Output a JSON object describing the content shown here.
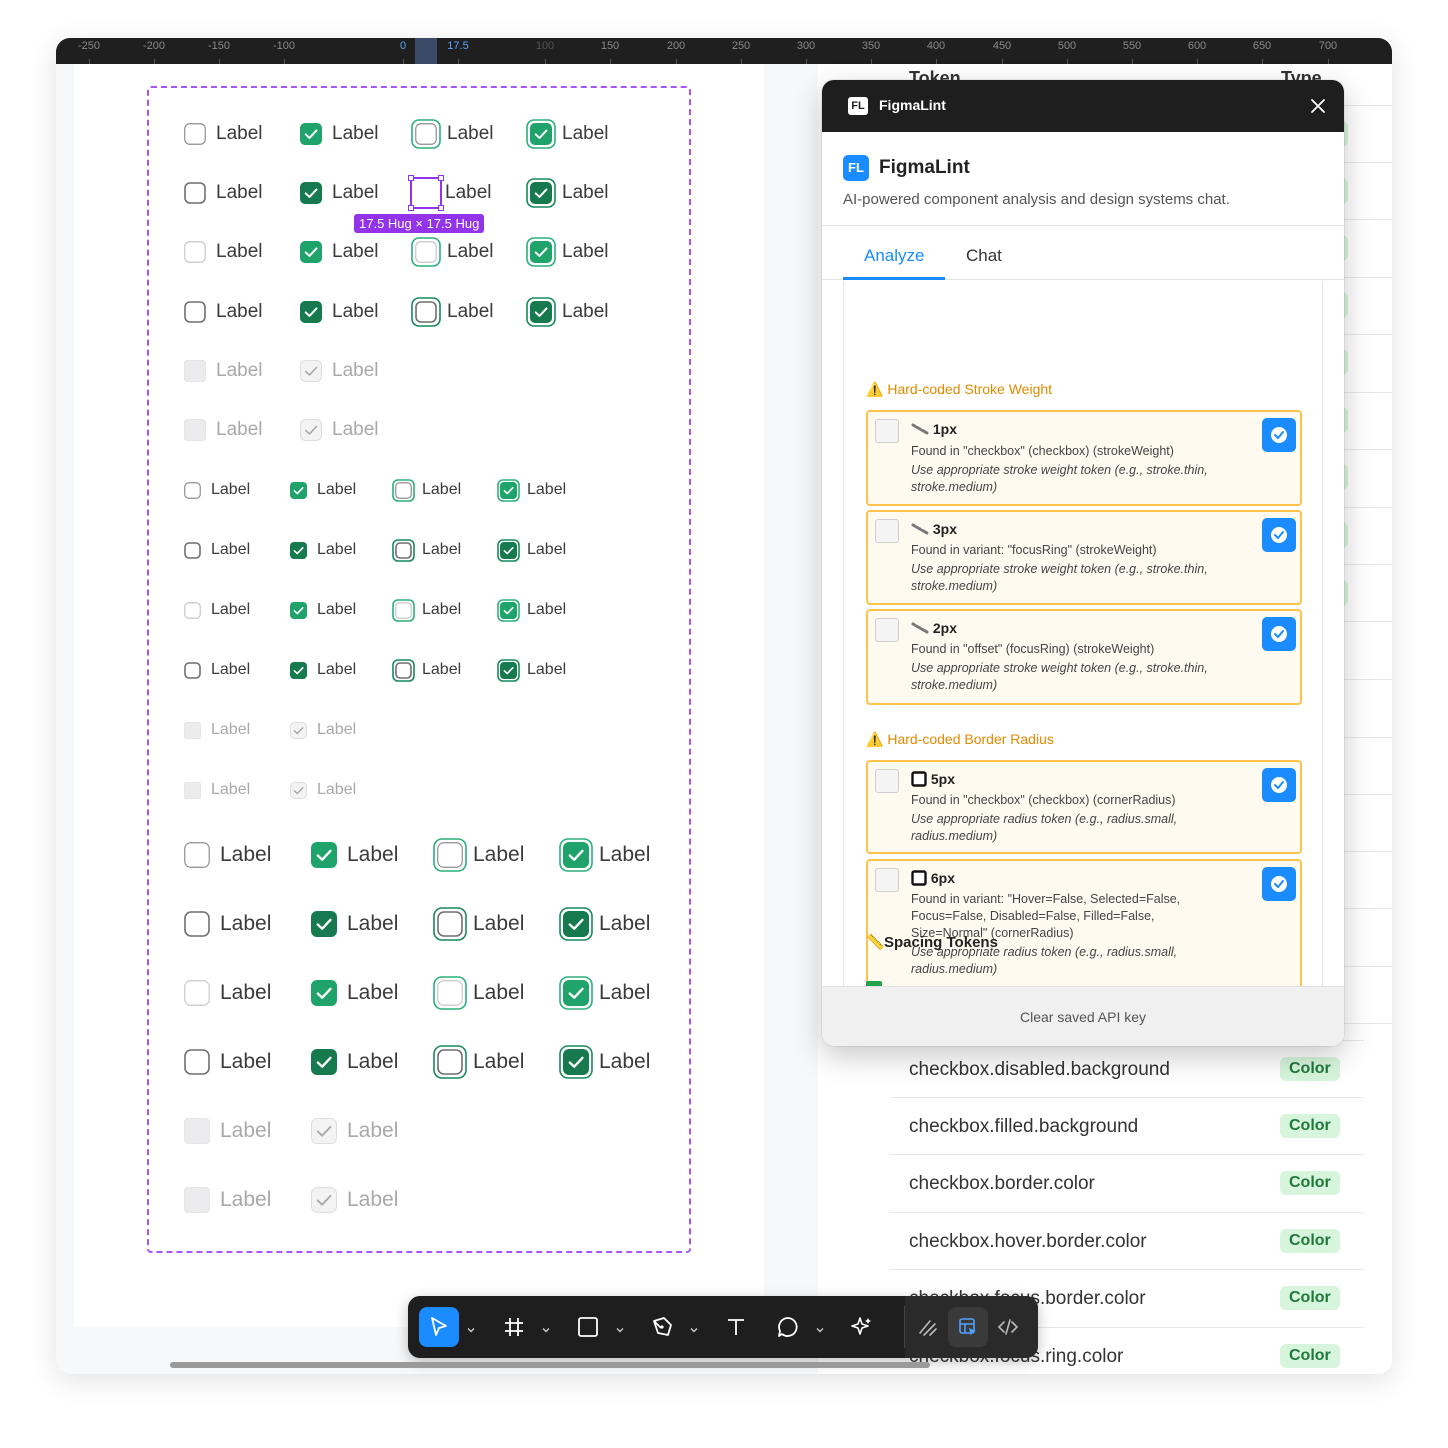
{
  "ruler": {
    "ticks": [
      "-250",
      "-200",
      "-150",
      "-100",
      "0",
      "17.5",
      "100",
      "150",
      "200",
      "250",
      "300",
      "350",
      "400",
      "450",
      "500",
      "550",
      "600",
      "650",
      "700"
    ]
  },
  "canvas": {
    "checkbox_label": "Label",
    "size_tag": "17.5 Hug × 17.5 Hug"
  },
  "tokens": {
    "header_token": "Token",
    "header_type": "Type",
    "rows": [
      {
        "name": "checkbox.disabled.background",
        "type": "Color"
      },
      {
        "name": "checkbox.filled.background",
        "type": "Color"
      },
      {
        "name": "checkbox.border.color",
        "type": "Color"
      },
      {
        "name": "checkbox.hover.border.color",
        "type": "Color"
      },
      {
        "name": "checkbox.focus.border.color",
        "type": "Color"
      },
      {
        "name": "checkbox.focus.ring.color",
        "type": "Color"
      }
    ]
  },
  "plugin": {
    "window_title": "FigmaLint",
    "logo_text": "FL",
    "name": "FigmaLint",
    "description": "AI-powered component analysis and design systems chat.",
    "tabs": [
      {
        "label": "Analyze",
        "active": true
      },
      {
        "label": "Chat",
        "active": false
      }
    ],
    "sections": [
      {
        "title": "Hard-coded Stroke Weight",
        "icon": "warning-icon",
        "issues": [
          {
            "value": "1px",
            "icon": "ruler-icon",
            "found": "Found in \"checkbox\" (checkbox) (strokeWeight)",
            "suggestion": "Use appropriate stroke weight token (e.g., stroke.thin, stroke.medium)"
          },
          {
            "value": "3px",
            "icon": "ruler-icon",
            "found": "Found in variant: \"focusRing\" (strokeWeight)",
            "suggestion": "Use appropriate stroke weight token (e.g., stroke.thin, stroke.medium)"
          },
          {
            "value": "2px",
            "icon": "ruler-icon",
            "found": "Found in \"offset\" (focusRing) (strokeWeight)",
            "suggestion": "Use appropriate stroke weight token (e.g., stroke.thin, stroke.medium)"
          }
        ]
      },
      {
        "title": "Hard-coded Border Radius",
        "icon": "warning-icon",
        "issues": [
          {
            "value": "5px",
            "icon": "square-icon",
            "found": "Found in \"checkbox\" (checkbox) (cornerRadius)",
            "suggestion": "Use appropriate radius token (e.g., radius.small, radius.medium)"
          },
          {
            "value": "6px",
            "icon": "square-icon",
            "found": "Found in variant: \"Hover=False, Selected=False, Focus=False, Disabled=False, Filled=False, Size=Normal\" (cornerRadius)",
            "suggestion": "Use appropriate radius token (e.g., radius.small, radius.medium)"
          }
        ]
      }
    ],
    "spacing_title": "Spacing Tokens",
    "footer_link": "Clear saved API key"
  },
  "colors": {
    "accent": "#1a8cff",
    "checkbox_green": "#1fa36a",
    "checkbox_dark_green": "#177a4e",
    "selection_purple": "#9333ea",
    "warning_orange": "#e08a00",
    "token_badge_bg": "#d7f5dc"
  }
}
